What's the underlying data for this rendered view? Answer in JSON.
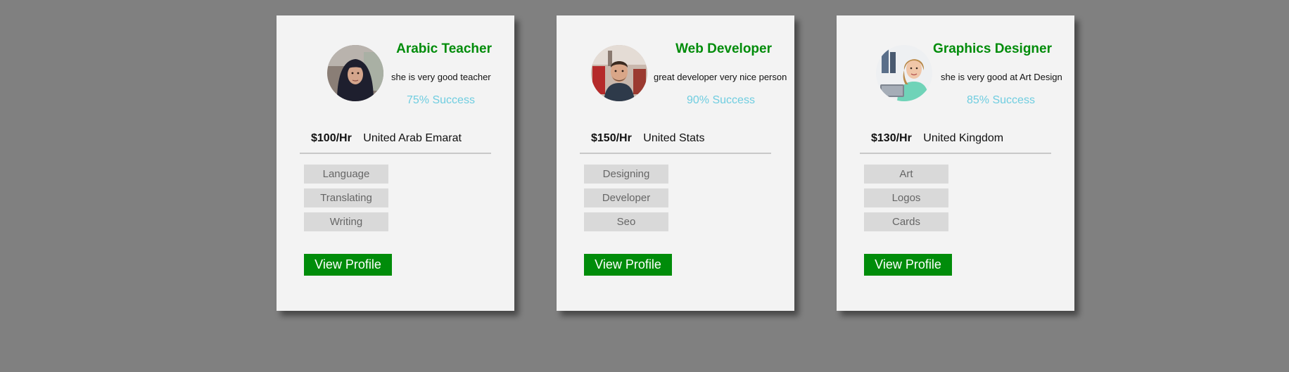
{
  "colors": {
    "background": "#808080",
    "card": "#f3f3f3",
    "title_green": "#008c0a",
    "success_blue": "#6fcde0",
    "tag_bg": "#d9d9d9",
    "button_bg": "#008c0a"
  },
  "cards": [
    {
      "avatar_icon": "woman-in-hijab-avatar",
      "title": "Arabic Teacher",
      "description": "she is very good teacher",
      "success": "75% Success",
      "rate": "$100/Hr",
      "country": "United Arab Emarat",
      "tags": [
        "Language",
        "Translating",
        "Writing"
      ],
      "button_label": "View Profile"
    },
    {
      "avatar_icon": "man-in-office-avatar",
      "title": "Web Developer",
      "description": "great developer very nice person",
      "success": "90% Success",
      "rate": "$150/Hr",
      "country": "United Stats",
      "tags": [
        "Designing",
        "Developer",
        "Seo"
      ],
      "button_label": "View Profile"
    },
    {
      "avatar_icon": "woman-with-laptop-avatar",
      "title": "Graphics Designer",
      "description": "she is very good at Art Design",
      "success": "85% Success",
      "rate": "$130/Hr",
      "country": "United Kingdom",
      "tags": [
        "Art",
        "Logos",
        "Cards"
      ],
      "button_label": "View Profile"
    }
  ]
}
